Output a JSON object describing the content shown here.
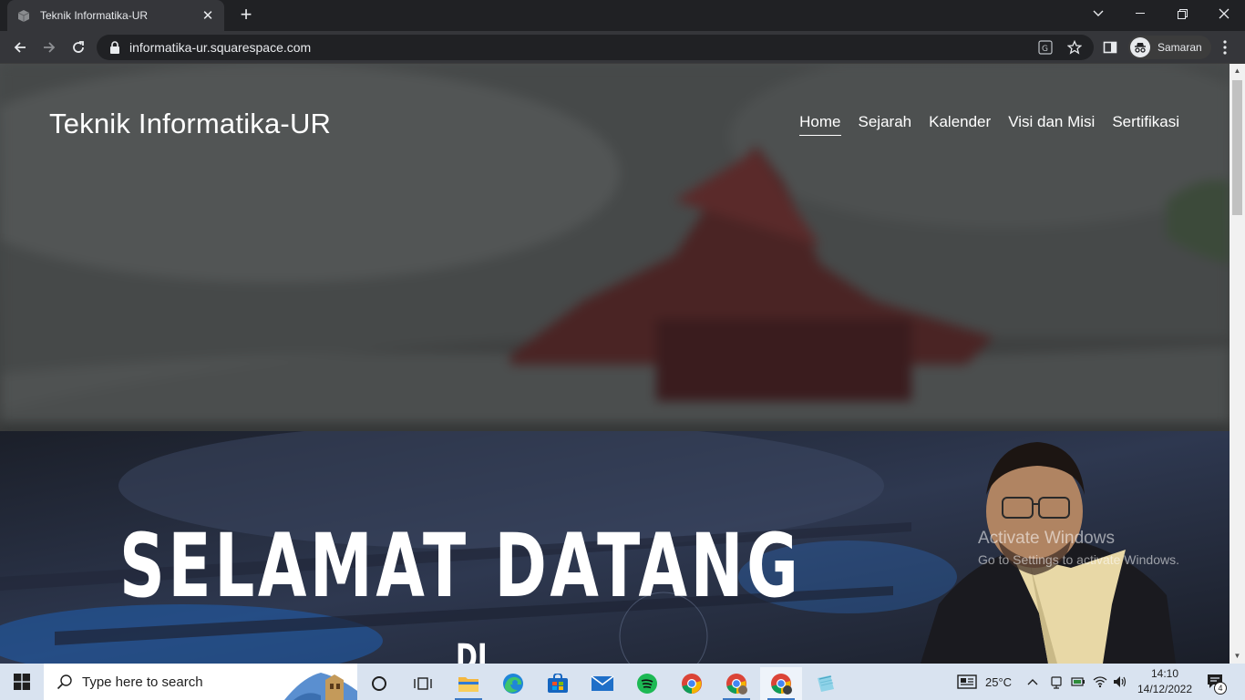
{
  "browser": {
    "tab_title": "Teknik Informatika-UR",
    "url": "informatika-ur.squarespace.com",
    "profile_name": "Samaran"
  },
  "site": {
    "title": "Teknik Informatika-UR",
    "nav": [
      {
        "label": "Home",
        "active": true
      },
      {
        "label": "Sejarah",
        "active": false
      },
      {
        "label": "Kalender",
        "active": false
      },
      {
        "label": "Visi dan Misi",
        "active": false
      },
      {
        "label": "Sertifikasi",
        "active": false
      }
    ],
    "banner": {
      "headline": "SELAMAT DATANG",
      "sub": "DI"
    }
  },
  "watermark": {
    "heading": "Activate Windows",
    "sub": "Go to Settings to activate Windows."
  },
  "taskbar": {
    "search_placeholder": "Type here to search",
    "weather": "25°C",
    "time": "14:10",
    "date": "14/12/2022",
    "notification_count": "4",
    "apps": [
      "task-view",
      "file-explorer",
      "edge",
      "microsoft-store",
      "mail",
      "spotify",
      "chrome",
      "chrome-profile-1",
      "chrome-profile-2",
      "notepad"
    ]
  },
  "colors": {
    "chrome_dark": "#202124",
    "chrome_tab": "#35363a",
    "taskbar": "#d9e3f0",
    "text_light": "#e8eaed"
  }
}
